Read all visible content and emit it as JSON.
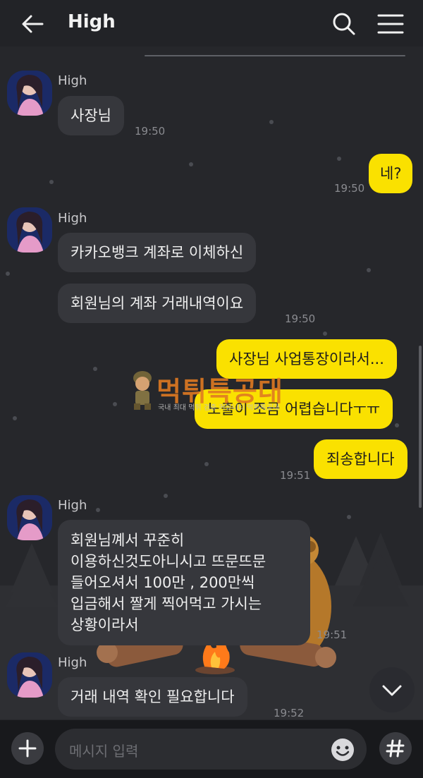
{
  "header": {
    "title": "High",
    "back_icon": "arrow-left-icon",
    "search_icon": "search-icon",
    "menu_icon": "hamburger-menu-icon"
  },
  "messages": [
    {
      "sender": "High",
      "text": "사장님",
      "time": "19:50"
    },
    {
      "text": "네?",
      "time": "19:50"
    },
    {
      "sender": "High",
      "text": "카카오뱅크 계좌로 이체하신"
    },
    {
      "text": "회원님의 계좌 거래내역이요",
      "time": "19:50"
    },
    {
      "text": "사장님 사업통장이라서..."
    },
    {
      "text": "노출이 조금 어렵습니다ㅜㅠ"
    },
    {
      "text": "죄송합니다",
      "time": "19:51"
    },
    {
      "sender": "High",
      "lines": [
        "회원님꼐서 꾸준히",
        "이용하신것도아니시고 뜨문뜨문",
        "들어오셔서 100만 , 200만씩",
        "입금해서 짤게 찍어먹고 가시는",
        "상황이라서"
      ],
      "time": "19:51"
    },
    {
      "sender": "High",
      "text": "거래 내역 확인 필요합니다",
      "time": "19:52"
    }
  ],
  "watermark": {
    "title": "먹튀특공대",
    "subtitle": "국내 최대 먹튀 검증 커뮤니티 먹튀특공대"
  },
  "input": {
    "placeholder": "메시지 입력",
    "plus_icon": "plus-icon",
    "emoji_icon": "emoji-icon",
    "hash_icon": "hash-icon"
  },
  "scroll_down_icon": "chevron-down-icon",
  "colors": {
    "background": "#26272b",
    "incoming_bubble": "#36373c",
    "outgoing_bubble": "#fae100",
    "watermark": "#e07a22"
  }
}
